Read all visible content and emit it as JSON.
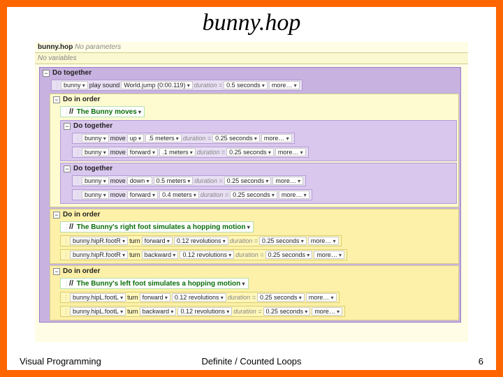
{
  "slide": {
    "title": "bunny.hop",
    "footer_left": "Visual Programming",
    "footer_center": "Definite / Counted Loops",
    "footer_right": "6"
  },
  "editor": {
    "sig_label": "bunny.hop",
    "sig_params": "No parameters",
    "vars": "No variables",
    "minus": "−",
    "slashslash": "//",
    "do_together": "Do together",
    "do_in_order": "Do in order",
    "more": "more…",
    "duration_eq": "duration =",
    "sound_row": {
      "obj": "bunny",
      "act": "play sound",
      "arg": "World.jump (0:00.119)",
      "dur": "0.5 seconds"
    },
    "comment1": "The Bunny moves",
    "move_up": {
      "obj": "bunny",
      "act": "move",
      "dir": "up",
      "amt": ".5 meters",
      "dur": "0.25 seconds"
    },
    "move_fwd1": {
      "obj": "bunny",
      "act": "move",
      "dir": "forward",
      "amt": ".1 meters",
      "dur": "0.25 seconds"
    },
    "move_down": {
      "obj": "bunny",
      "act": "move",
      "dir": "down",
      "amt": "0.5 meters",
      "dur": "0.25 seconds"
    },
    "move_fwd2": {
      "obj": "bunny",
      "act": "move",
      "dir": "forward",
      "amt": "0.4 meters",
      "dur": "0.25 seconds"
    },
    "comment2": "The Bunny's right foot simulates a hopping motion",
    "rfoot_fwd": {
      "obj": "bunny.hipR.footR",
      "act": "turn",
      "dir": "forward",
      "amt": "0.12 revolutions",
      "dur": "0.25 seconds"
    },
    "rfoot_back": {
      "obj": "bunny.hipR.footR",
      "act": "turn",
      "dir": "backward",
      "amt": "0.12 revolutions",
      "dur": "0.25 seconds"
    },
    "comment3": "The Bunny's left foot simulates a hopping motion",
    "lfoot_fwd": {
      "obj": "bunny.hipL.footL",
      "act": "turn",
      "dir": "forward",
      "amt": "0.12 revolutions",
      "dur": "0.25 seconds"
    },
    "lfoot_back": {
      "obj": "bunny.hipL.footL",
      "act": "turn",
      "dir": "backward",
      "amt": "0.12 revolutions",
      "dur": "0.25 seconds"
    }
  }
}
